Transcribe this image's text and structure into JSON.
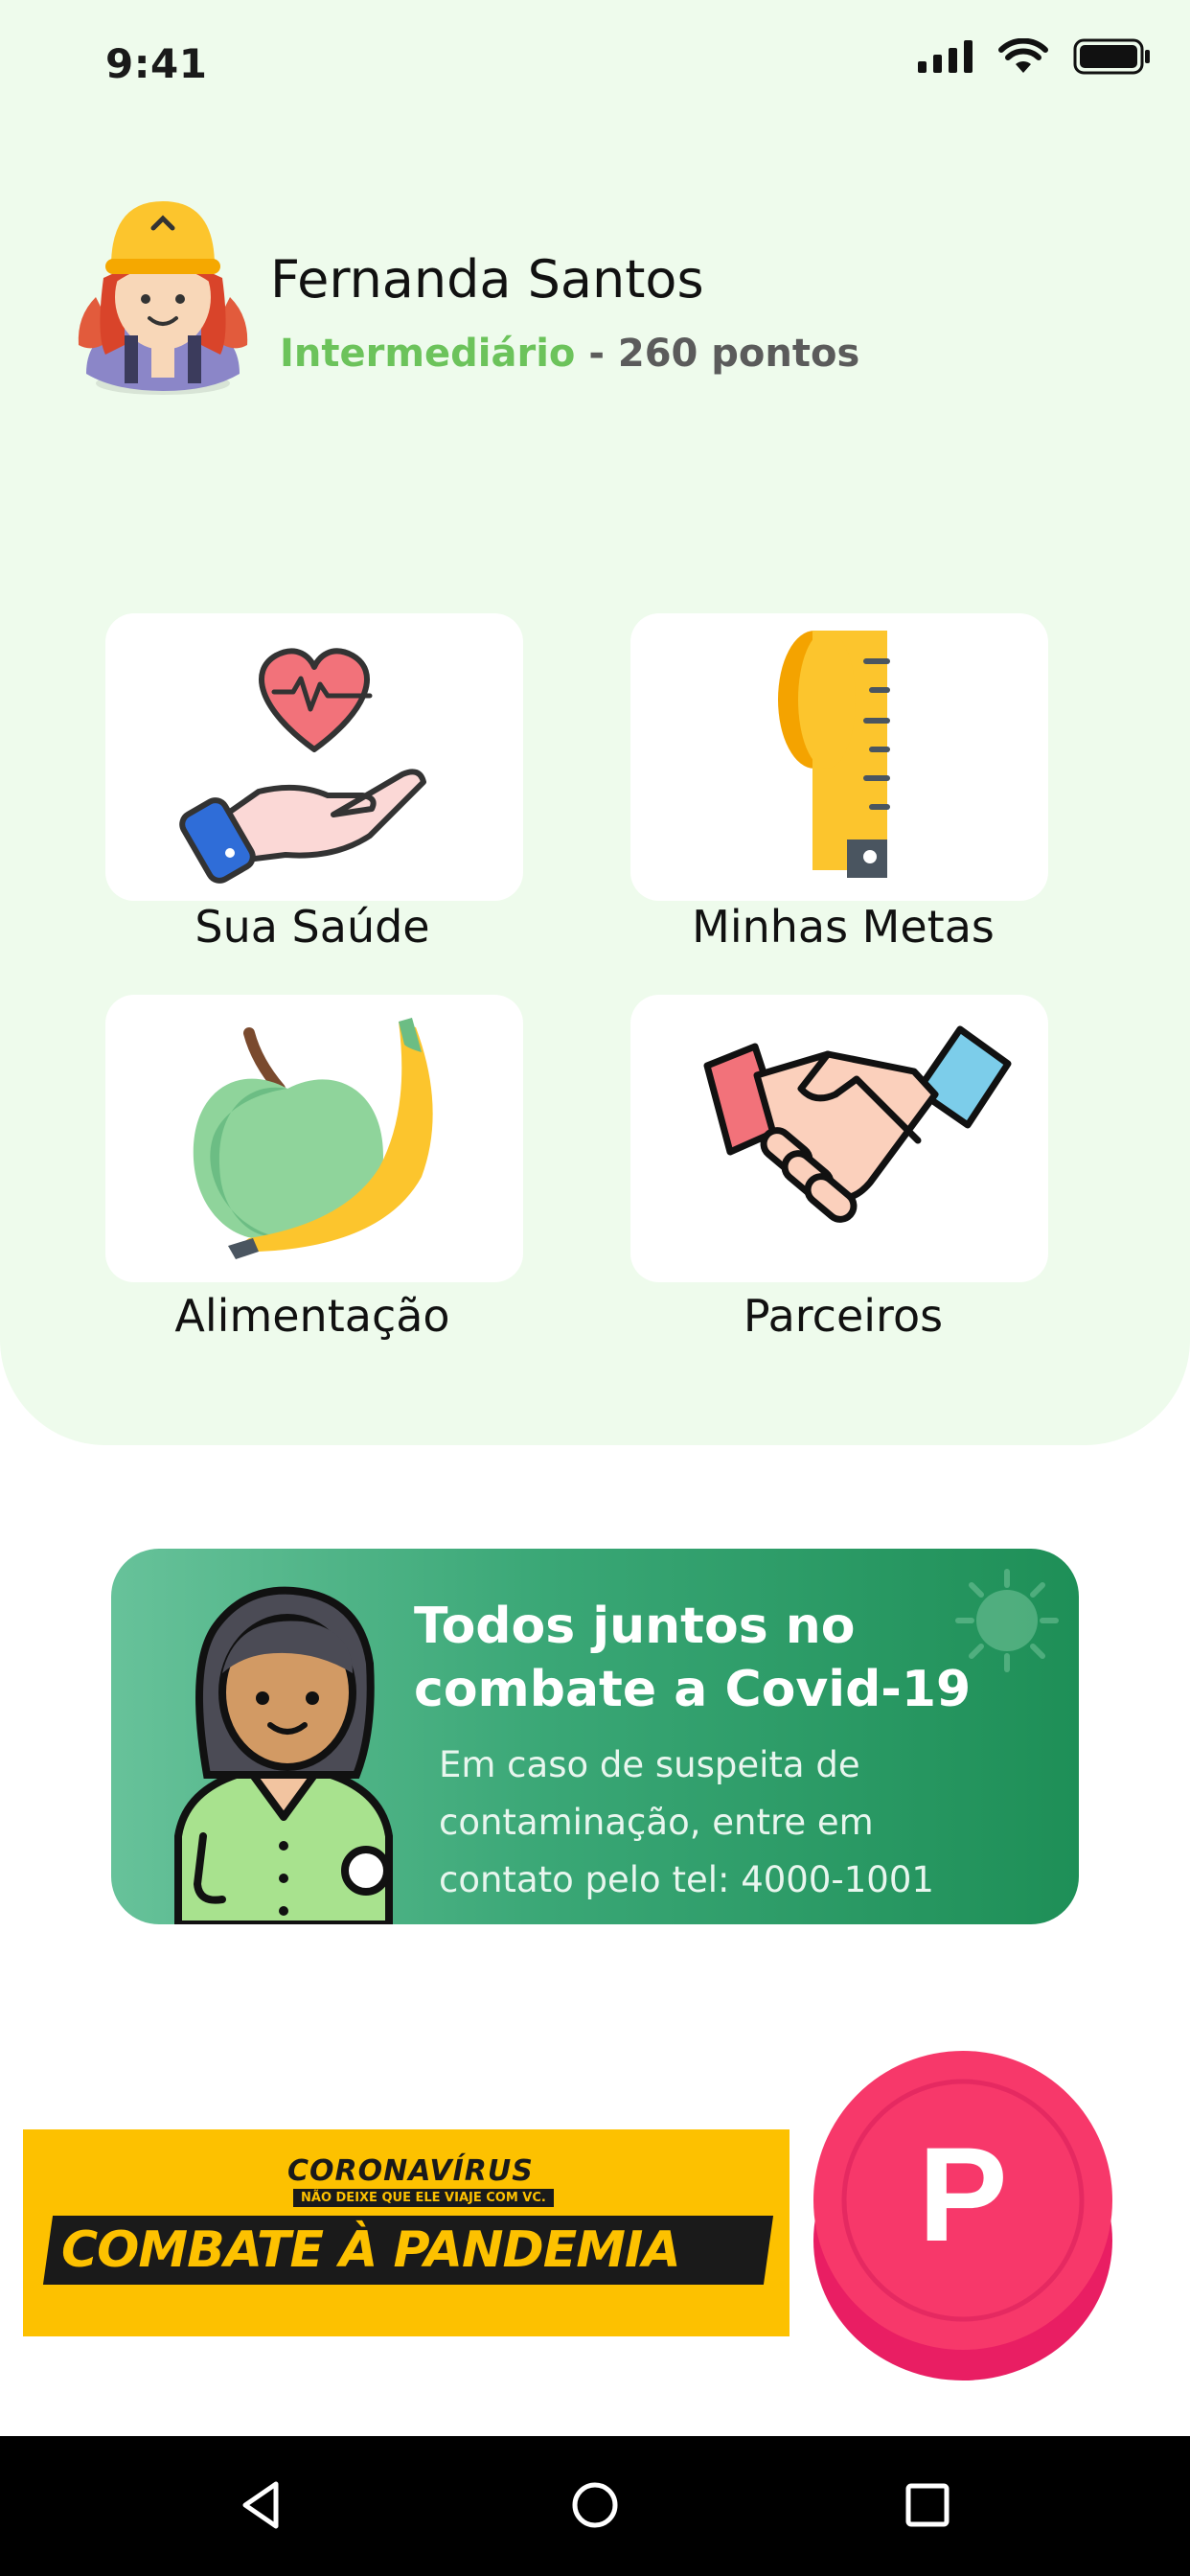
{
  "status_bar": {
    "time": "9:41"
  },
  "profile": {
    "name": "Fernanda Santos",
    "level": "Intermediário",
    "points": " - 260 pontos"
  },
  "menu": [
    {
      "label": "Sua Saúde",
      "icon": "heart-hand-icon"
    },
    {
      "label": "Minhas Metas",
      "icon": "measuring-tape-icon"
    },
    {
      "label": "Alimentação",
      "icon": "apple-banana-icon"
    },
    {
      "label": "Parceiros",
      "icon": "handshake-icon"
    }
  ],
  "covid_banner": {
    "title": "Todos juntos no combate a Covid-19",
    "text": "Em caso de suspeita de contaminação, entre em contato pelo tel: 4000-1001"
  },
  "pandemic_banner": {
    "top": "CORONAVÍRUS",
    "sub": "NÃO DEIXE QUE ELE VIAJE COM VC.",
    "main": "COMBATE À PANDEMIA"
  },
  "fab": {
    "label": "P",
    "color": "#f7386a"
  },
  "colors": {
    "accent_green": "#6cc35b",
    "background": "#eefbec",
    "banner_green": "#2ea06a"
  }
}
